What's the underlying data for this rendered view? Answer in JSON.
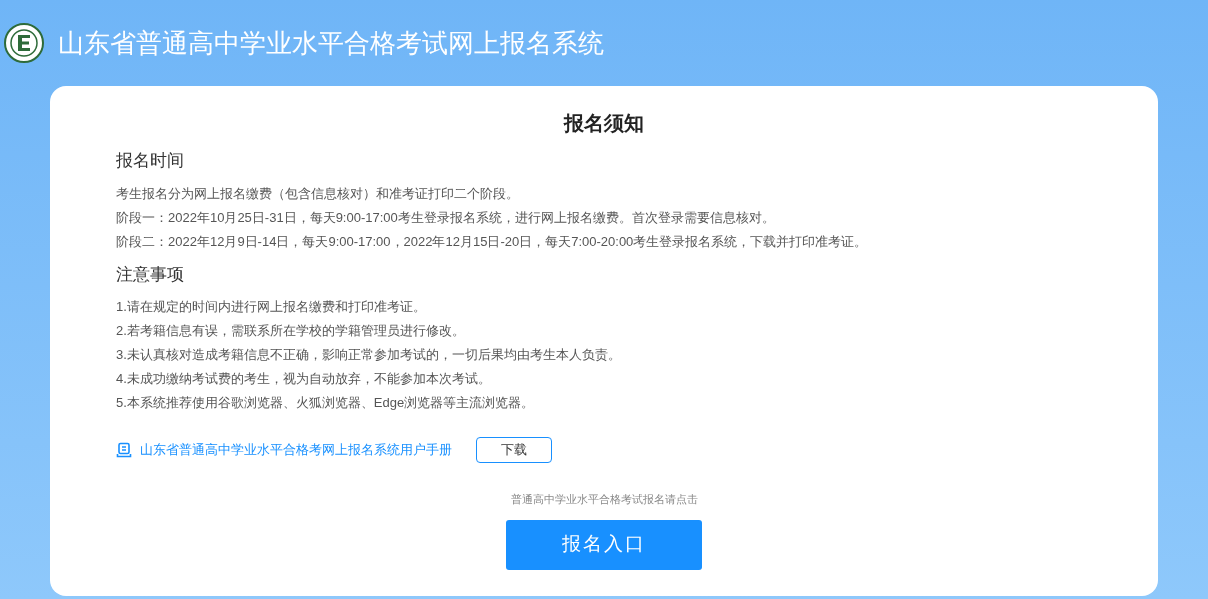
{
  "header": {
    "title": "山东省普通高中学业水平合格考试网上报名系统"
  },
  "notice": {
    "title": "报名须知",
    "sections": [
      {
        "heading": "报名时间",
        "lines": [
          "考生报名分为网上报名缴费（包含信息核对）和准考证打印二个阶段。",
          "阶段一：2022年10月25日-31日，每天9:00-17:00考生登录报名系统，进行网上报名缴费。首次登录需要信息核对。",
          "阶段二：2022年12月9日-14日，每天9:00-17:00，2022年12月15日-20日，每天7:00-20:00考生登录报名系统，下载并打印准考证。"
        ]
      },
      {
        "heading": "注意事项",
        "lines": [
          "1.请在规定的时间内进行网上报名缴费和打印准考证。",
          "2.若考籍信息有误，需联系所在学校的学籍管理员进行修改。",
          "3.未认真核对造成考籍信息不正确，影响正常参加考试的，一切后果均由考生本人负责。",
          "4.未成功缴纳考试费的考生，视为自动放弃，不能参加本次考试。",
          "5.本系统推荐使用谷歌浏览器、火狐浏览器、Edge浏览器等主流浏览器。"
        ]
      }
    ],
    "manual": {
      "link": "山东省普通高中学业水平合格考网上报名系统用户手册",
      "button": "下载"
    },
    "hint": "普通高中学业水平合格考试报名请点击",
    "entry_button": "报名入口"
  }
}
